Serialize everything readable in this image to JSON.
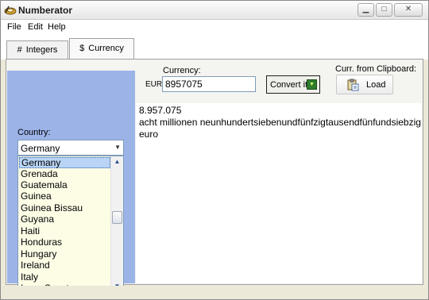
{
  "window": {
    "title": "Numberator"
  },
  "menu": {
    "items": [
      "File",
      "Edit",
      "Help"
    ]
  },
  "tabs": [
    {
      "glyph": "#",
      "label": "Integers"
    },
    {
      "glyph": "$",
      "label": "Currency"
    }
  ],
  "currency": {
    "label": "Currency:",
    "code": "EUR",
    "amount": "8957075",
    "convert_label": "Convert it",
    "clipboard_label": "Curr. from Clipboard:",
    "load_label": "Load"
  },
  "country": {
    "label": "Country:",
    "selected": "Germany",
    "list": [
      "Germany",
      "Grenada",
      "Guatemala",
      "Guinea",
      "Guinea Bissau",
      "Guyana",
      "Haiti",
      "Honduras",
      "Hungary",
      "Ireland",
      "Italy",
      "Ivory Coast"
    ]
  },
  "result": {
    "number": "8.957.075",
    "words": "acht millionen neunhundertsiebenundfünfzigtausendfünfundsiebzig",
    "unit": "euro"
  },
  "icons": {
    "app": "numberator-logo-icon",
    "convert": "arrow-down-icon",
    "load": "clipboard-icon"
  },
  "colors": {
    "side_panel": "#9cb3e8",
    "list_background": "#fdfde6",
    "selection": "#b9d4f4",
    "convert_icon": "#2e7d2e"
  }
}
